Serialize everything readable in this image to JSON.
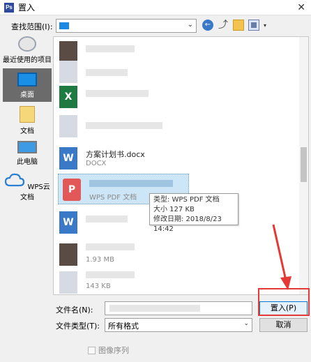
{
  "window": {
    "title": "置入",
    "app_icon": "Ps"
  },
  "toolbar": {
    "lookin_label": "查找范围(I):"
  },
  "places": [
    {
      "label": "最近使用的项目",
      "icon": "recent-icon"
    },
    {
      "label": "桌面",
      "icon": "desktop-icon",
      "selected": true
    },
    {
      "label": "文档",
      "icon": "documents-icon"
    },
    {
      "label": "此电脑",
      "icon": "pc-icon"
    },
    {
      "label": "WPS云文档",
      "icon": "cloud-icon"
    }
  ],
  "files": [
    {
      "name": "方案计划书.docx",
      "meta": "DOCX"
    },
    {
      "meta": "WPS PDF 文档"
    },
    {
      "meta": "1.93 MB"
    },
    {
      "meta": "143 KB"
    }
  ],
  "tooltip": {
    "type": "类型: WPS PDF 文档",
    "size": "大小 127 KB",
    "modified": "修改日期: 2018/8/23 14:42"
  },
  "form": {
    "filename_label": "文件名(N):",
    "filetype_label": "文件类型(T):",
    "filetype_value": "所有格式",
    "open_button": "置入(P)",
    "cancel_button": "取消",
    "sequence_label": "图像序列"
  },
  "colors": {
    "accent": "#0078d7",
    "annotation": "#e53935"
  }
}
